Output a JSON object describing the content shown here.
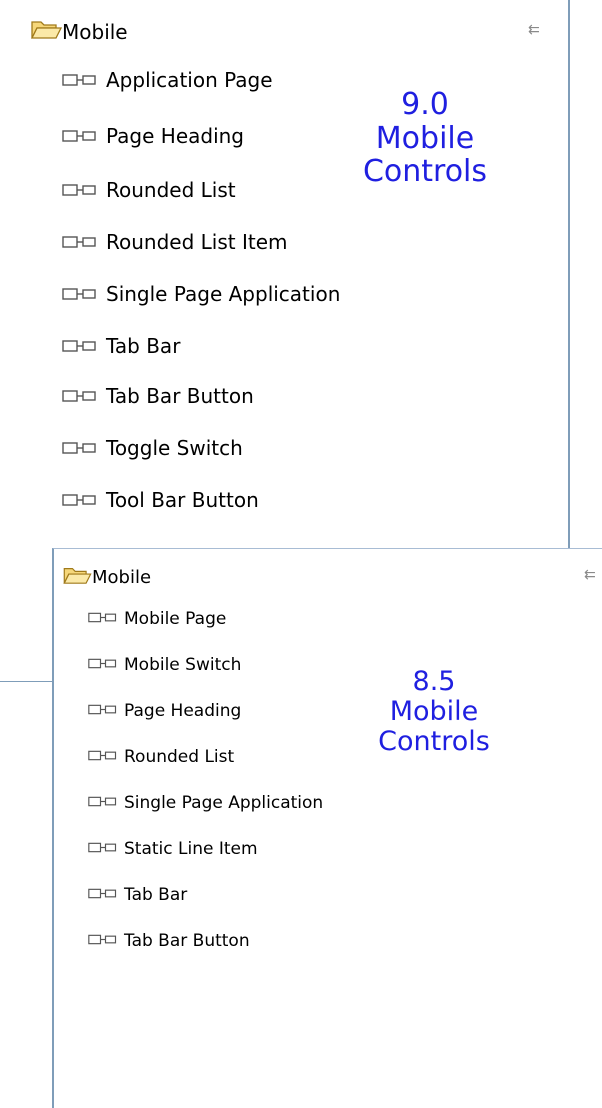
{
  "panel_90": {
    "header": "Mobile",
    "items": [
      "Application Page",
      "Page Heading",
      "Rounded List",
      "Rounded List Item",
      "Single Page Application",
      "Tab Bar",
      "Tab Bar Button",
      "Toggle Switch",
      "Tool Bar Button"
    ],
    "caption": [
      "9.0",
      "Mobile",
      "Controls"
    ]
  },
  "panel_85": {
    "header": "Mobile",
    "items": [
      "Mobile Page",
      "Mobile Switch",
      "Page Heading",
      "Rounded List",
      "Single Page Application",
      "Static Line Item",
      "Tab Bar",
      "Tab Bar Button"
    ],
    "caption": [
      "8.5",
      "Mobile",
      "Controls"
    ]
  },
  "colors": {
    "caption": "#1f1fe0",
    "border": "#7f9db9",
    "folder": "#e8b84a"
  },
  "icons": {
    "folder": "open-folder-icon",
    "item": "component-icon",
    "collapse": "collapse-icon"
  }
}
